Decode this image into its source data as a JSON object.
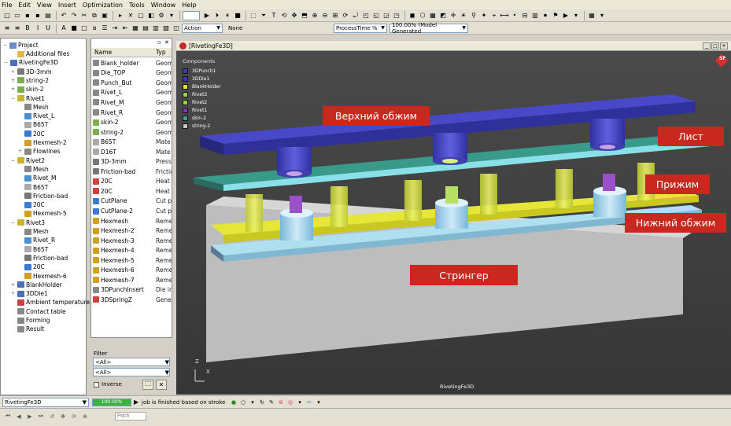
{
  "menu": [
    "File",
    "Edit",
    "View",
    "Insert",
    "Optimization",
    "Tools",
    "Window",
    "Help"
  ],
  "toolbar2": {
    "action_value": "Action",
    "none_label": "None",
    "process_value": "ProcessTime %",
    "zoom_value": "100.00% (Model Generated"
  },
  "tree": {
    "title": "Project",
    "items": [
      {
        "label": "Additional files",
        "level": 1,
        "icon": "folder-icon",
        "color": "#e6b84a",
        "exp": ""
      },
      {
        "label": "RivetingFe3D",
        "level": 0,
        "icon": "grid-icon",
        "color": "#4a6fbf",
        "exp": "−"
      },
      {
        "label": "3D-3mm",
        "level": 1,
        "icon": "press-icon",
        "color": "#777",
        "exp": "+"
      },
      {
        "label": "string-2",
        "level": 1,
        "icon": "part-icon",
        "color": "#7ab04a",
        "exp": "+"
      },
      {
        "label": "skin-2",
        "level": 1,
        "icon": "part-icon",
        "color": "#7ab04a",
        "exp": "+"
      },
      {
        "label": "Rivet1",
        "level": 1,
        "icon": "part-icon",
        "color": "#c8b430",
        "exp": "−"
      },
      {
        "label": "Mesh",
        "level": 2,
        "icon": "mesh-icon",
        "color": "#888",
        "exp": ""
      },
      {
        "label": "Rivet_L",
        "level": 2,
        "icon": "geometry-icon",
        "color": "#4a8fd0",
        "exp": ""
      },
      {
        "label": "B65T",
        "level": 2,
        "icon": "material-icon",
        "color": "#aaa",
        "exp": ""
      },
      {
        "label": "20C",
        "level": 2,
        "icon": "heat-icon",
        "color": "#3a7ad0",
        "exp": ""
      },
      {
        "label": "Hexmesh-2",
        "level": 2,
        "icon": "hexmesh-icon",
        "color": "#d0a020",
        "exp": ""
      },
      {
        "label": "Flowlines",
        "level": 2,
        "icon": "flowlines-icon",
        "color": "#888",
        "exp": "+"
      },
      {
        "label": "Rivet2",
        "level": 1,
        "icon": "part-icon",
        "color": "#c8b430",
        "exp": "−"
      },
      {
        "label": "Mesh",
        "level": 2,
        "icon": "mesh-icon",
        "color": "#888",
        "exp": ""
      },
      {
        "label": "Rivet_M",
        "level": 2,
        "icon": "geometry-icon",
        "color": "#4a8fd0",
        "exp": ""
      },
      {
        "label": "B65T",
        "level": 2,
        "icon": "material-icon",
        "color": "#aaa",
        "exp": ""
      },
      {
        "label": "Friction-bad",
        "level": 2,
        "icon": "friction-icon",
        "color": "#777",
        "exp": ""
      },
      {
        "label": "20C",
        "level": 2,
        "icon": "heat-icon",
        "color": "#3a7ad0",
        "exp": ""
      },
      {
        "label": "Hexmesh-5",
        "level": 2,
        "icon": "hexmesh-icon",
        "color": "#d0a020",
        "exp": ""
      },
      {
        "label": "Rivet3",
        "level": 1,
        "icon": "part-icon",
        "color": "#c8b430",
        "exp": "−"
      },
      {
        "label": "Mesh",
        "level": 2,
        "icon": "mesh-icon",
        "color": "#888",
        "exp": ""
      },
      {
        "label": "Rivet_R",
        "level": 2,
        "icon": "geometry-icon",
        "color": "#4a8fd0",
        "exp": ""
      },
      {
        "label": "B65T",
        "level": 2,
        "icon": "material-icon",
        "color": "#aaa",
        "exp": ""
      },
      {
        "label": "Friction-bad",
        "level": 2,
        "icon": "friction-icon",
        "color": "#777",
        "exp": ""
      },
      {
        "label": "20C",
        "level": 2,
        "icon": "heat-icon",
        "color": "#3a7ad0",
        "exp": ""
      },
      {
        "label": "Hexmesh-6",
        "level": 2,
        "icon": "hexmesh-icon",
        "color": "#d0a020",
        "exp": ""
      },
      {
        "label": "BlankHolder",
        "level": 1,
        "icon": "part-icon",
        "color": "#4a6fbf",
        "exp": "+"
      },
      {
        "label": "3DDie1",
        "level": 1,
        "icon": "part-icon",
        "color": "#4a6fbf",
        "exp": "+"
      },
      {
        "label": "Ambient temperature",
        "level": 1,
        "icon": "thermometer-icon",
        "color": "#d04040",
        "exp": ""
      },
      {
        "label": "Contact table",
        "level": 1,
        "icon": "table-icon",
        "color": "#888",
        "exp": ""
      },
      {
        "label": "Forming",
        "level": 1,
        "icon": "forming-icon",
        "color": "#888",
        "exp": ""
      },
      {
        "label": "Result",
        "level": 1,
        "icon": "result-icon",
        "color": "#888",
        "exp": ""
      }
    ]
  },
  "objects": {
    "col_name": "Name",
    "col_type": "Typ",
    "rows": [
      {
        "name": "Blank_holder",
        "type": "Geom",
        "color": "#888"
      },
      {
        "name": "Die_TOP",
        "type": "Geom",
        "color": "#888"
      },
      {
        "name": "Punch_But",
        "type": "Geom",
        "color": "#888"
      },
      {
        "name": "Rivet_L",
        "type": "Geom",
        "color": "#888"
      },
      {
        "name": "Rivet_M",
        "type": "Geom",
        "color": "#888"
      },
      {
        "name": "Rivet_R",
        "type": "Geom",
        "color": "#888"
      },
      {
        "name": "skin-2",
        "type": "Geom",
        "color": "#7ab04a"
      },
      {
        "name": "string-2",
        "type": "Geom",
        "color": "#7ab04a"
      },
      {
        "name": "B65T",
        "type": "Mate",
        "color": "#aaa"
      },
      {
        "name": "D16T",
        "type": "Mate",
        "color": "#aaa"
      },
      {
        "name": "3D-3mm",
        "type": "Press",
        "color": "#777"
      },
      {
        "name": "Friction-bad",
        "type": "Frictio",
        "color": "#777"
      },
      {
        "name": "20C",
        "type": "Heat",
        "color": "#d04040"
      },
      {
        "name": "20C",
        "type": "Heat",
        "color": "#d04040"
      },
      {
        "name": "CutPlane",
        "type": "Cut p",
        "color": "#3a7ad0"
      },
      {
        "name": "CutPlane-2",
        "type": "Cut p",
        "color": "#3a7ad0"
      },
      {
        "name": "Hexmesh",
        "type": "Reme",
        "color": "#d0a020"
      },
      {
        "name": "Hexmesh-2",
        "type": "Reme",
        "color": "#d0a020"
      },
      {
        "name": "Hexmesh-3",
        "type": "Reme",
        "color": "#d0a020"
      },
      {
        "name": "Hexmesh-4",
        "type": "Reme",
        "color": "#d0a020"
      },
      {
        "name": "Hexmesh-5",
        "type": "Reme",
        "color": "#d0a020"
      },
      {
        "name": "Hexmesh-6",
        "type": "Reme",
        "color": "#d0a020"
      },
      {
        "name": "Hexmesh-7",
        "type": "Reme",
        "color": "#d0a020"
      },
      {
        "name": "3DPunchInsert",
        "type": "Die in",
        "color": "#888"
      },
      {
        "name": "3DSpringZ",
        "type": "Gene",
        "color": "#d04040"
      }
    ]
  },
  "filter": {
    "label": "Filter",
    "combo1": "<All>",
    "combo2": "<All>",
    "inverse_label": "Inverse"
  },
  "viewport": {
    "title": "[RivetingFe3D]",
    "components_label": "Components",
    "legend": [
      {
        "name": "3DPunch1",
        "color": "#3c3cb4"
      },
      {
        "name": "3DDie1",
        "color": "#3c3cb4"
      },
      {
        "name": "BlankHolder",
        "color": "#e0e040"
      },
      {
        "name": "Rivet3",
        "color": "#9ad24a"
      },
      {
        "name": "Rivet2",
        "color": "#9ad24a"
      },
      {
        "name": "Rivet1",
        "color": "#7a3cb4"
      },
      {
        "name": "skin-2",
        "color": "#3ca096"
      },
      {
        "name": "string-2",
        "color": "#c8c8c8"
      }
    ],
    "callouts": {
      "top_die": "Верхний обжим",
      "sheet": "Лист",
      "clamp": "Прижим",
      "bottom_die": "Нижний обжим",
      "stringer": "Стрингер"
    },
    "caption": "RivetingFe3D",
    "axis_z": "Z",
    "axis_x": "X",
    "badge": "SF"
  },
  "status": {
    "project_value": "RivetingFe3D",
    "progress_text": "100.00%",
    "progress_value": 1.0,
    "message": "job is finished based on stroke"
  },
  "bottom": {
    "pitch_placeholder": "Pitch"
  }
}
